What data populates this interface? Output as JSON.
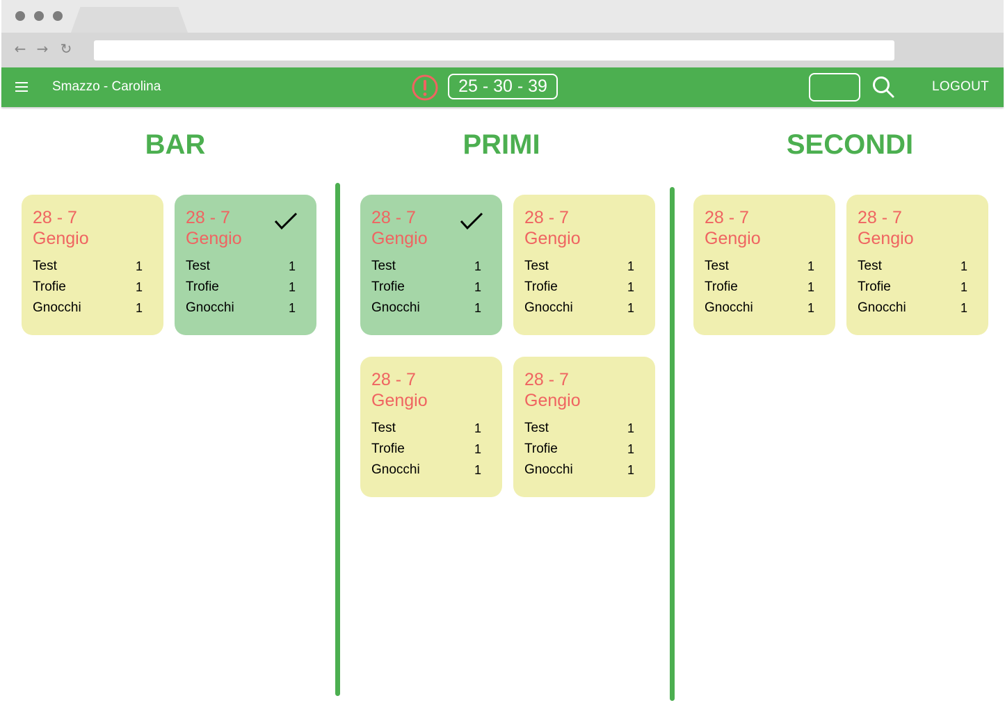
{
  "header": {
    "title": "Smazzo - Carolina",
    "counter": "25 - 30 - 39",
    "logout_label": "LOGOUT",
    "search_value": ""
  },
  "colors": {
    "primary": "#4caf50",
    "card_pending": "#f0efb0",
    "card_done": "#a5d6a7",
    "accent_text": "#ef6461"
  },
  "columns": [
    {
      "title": "BAR",
      "cards": [
        {
          "table": "28 - 7",
          "name": "Gengio",
          "done": false,
          "items": [
            {
              "label": "Test",
              "qty": "1"
            },
            {
              "label": "Trofie",
              "qty": "1"
            },
            {
              "label": "Gnocchi",
              "qty": "1"
            }
          ]
        },
        {
          "table": "28 - 7",
          "name": "Gengio",
          "done": true,
          "items": [
            {
              "label": "Test",
              "qty": "1"
            },
            {
              "label": "Trofie",
              "qty": "1"
            },
            {
              "label": "Gnocchi",
              "qty": "1"
            }
          ]
        }
      ]
    },
    {
      "title": "PRIMI",
      "cards": [
        {
          "table": "28 - 7",
          "name": "Gengio",
          "done": true,
          "items": [
            {
              "label": "Test",
              "qty": "1"
            },
            {
              "label": "Trofie",
              "qty": "1"
            },
            {
              "label": "Gnocchi",
              "qty": "1"
            }
          ]
        },
        {
          "table": "28 - 7",
          "name": "Gengio",
          "done": false,
          "items": [
            {
              "label": "Test",
              "qty": "1"
            },
            {
              "label": "Trofie",
              "qty": "1"
            },
            {
              "label": "Gnocchi",
              "qty": "1"
            }
          ]
        },
        {
          "table": "28 - 7",
          "name": "Gengio",
          "done": false,
          "items": [
            {
              "label": "Test",
              "qty": "1"
            },
            {
              "label": "Trofie",
              "qty": "1"
            },
            {
              "label": "Gnocchi",
              "qty": "1"
            }
          ]
        },
        {
          "table": "28 - 7",
          "name": "Gengio",
          "done": false,
          "items": [
            {
              "label": "Test",
              "qty": "1"
            },
            {
              "label": "Trofie",
              "qty": "1"
            },
            {
              "label": "Gnocchi",
              "qty": "1"
            }
          ]
        }
      ]
    },
    {
      "title": "SECONDI",
      "cards": [
        {
          "table": "28 - 7",
          "name": "Gengio",
          "done": false,
          "items": [
            {
              "label": "Test",
              "qty": "1"
            },
            {
              "label": "Trofie",
              "qty": "1"
            },
            {
              "label": "Gnocchi",
              "qty": "1"
            }
          ]
        },
        {
          "table": "28 - 7",
          "name": "Gengio",
          "done": false,
          "items": [
            {
              "label": "Test",
              "qty": "1"
            },
            {
              "label": "Trofie",
              "qty": "1"
            },
            {
              "label": "Gnocchi",
              "qty": "1"
            }
          ]
        }
      ]
    }
  ]
}
